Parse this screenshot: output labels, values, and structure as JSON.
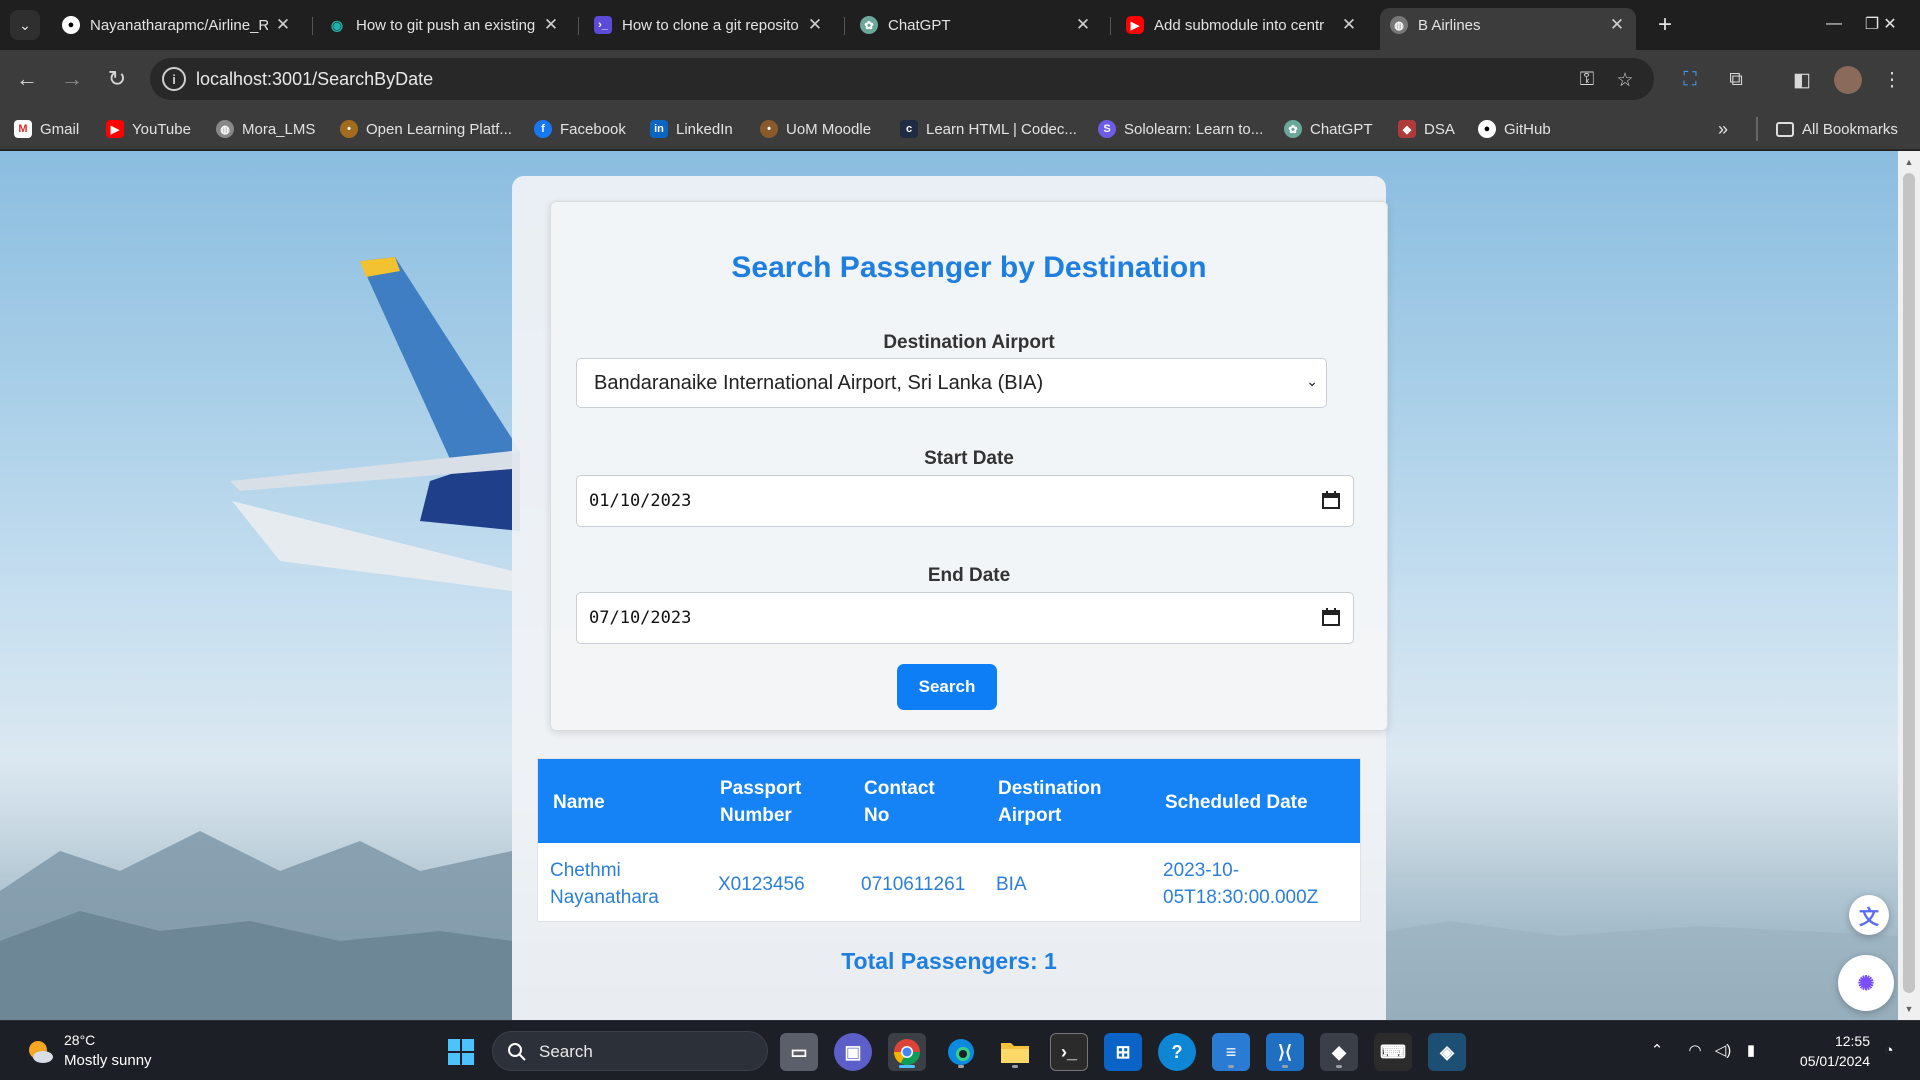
{
  "browser": {
    "tabs": [
      {
        "title": "Nayanatharapmc/Airline_R",
        "icon": "github-icon"
      },
      {
        "title": "How to git push an existing",
        "icon": "eye-icon"
      },
      {
        "title": "How to clone a git reposito",
        "icon": "terminal-icon"
      },
      {
        "title": "ChatGPT",
        "icon": "chatgpt-icon"
      },
      {
        "title": "Add submodule into centr",
        "icon": "youtube-icon"
      },
      {
        "title": "B Airlines",
        "icon": "globe-icon"
      }
    ],
    "url": "localhost:3001/SearchByDate",
    "bookmarks": [
      {
        "label": "Gmail",
        "icon": "gmail-icon"
      },
      {
        "label": "YouTube",
        "icon": "youtube-icon"
      },
      {
        "label": "Mora_LMS",
        "icon": "globe-icon"
      },
      {
        "label": "Open Learning Platf...",
        "icon": "open-learning-icon"
      },
      {
        "label": "Facebook",
        "icon": "facebook-icon"
      },
      {
        "label": "LinkedIn",
        "icon": "linkedin-icon"
      },
      {
        "label": "UoM Moodle",
        "icon": "moodle-icon"
      },
      {
        "label": "Learn HTML | Codec...",
        "icon": "codecademy-icon"
      },
      {
        "label": "Sololearn: Learn to...",
        "icon": "sololearn-icon"
      },
      {
        "label": "ChatGPT",
        "icon": "chatgpt-icon"
      },
      {
        "label": "DSA",
        "icon": "dsa-icon"
      },
      {
        "label": "GitHub",
        "icon": "github-icon"
      }
    ],
    "all_bookmarks": "All Bookmarks"
  },
  "page": {
    "title": "Search Passenger by Destination",
    "destination_label": "Destination Airport",
    "destination_value": "Bandaranaike International Airport, Sri Lanka (BIA)",
    "start_label": "Start Date",
    "start_value": "01/10/2023",
    "end_label": "End Date",
    "end_value": "07/10/2023",
    "search_button": "Search",
    "table": {
      "headers": [
        [
          "Name"
        ],
        [
          "Passport",
          "Number"
        ],
        [
          "Contact",
          "No"
        ],
        [
          "Destination",
          "Airport"
        ],
        [
          "Scheduled Date"
        ]
      ],
      "rows": [
        {
          "name": [
            "Chethmi",
            "Nayanathara"
          ],
          "passport": "X0123456",
          "contact": "0710611261",
          "destination": "BIA",
          "scheduled": [
            "2023-10-",
            "05T18:30:00.000Z"
          ]
        }
      ]
    },
    "total": "Total Passengers: 1"
  },
  "taskbar": {
    "weather_temp": "28°C",
    "weather_desc": "Mostly sunny",
    "search_placeholder": "Search",
    "time": "12:55",
    "date": "05/01/2024"
  },
  "colors": {
    "accent": "#1f7fe0",
    "table_header": "#1583f5",
    "button": "#0d7ef5"
  }
}
